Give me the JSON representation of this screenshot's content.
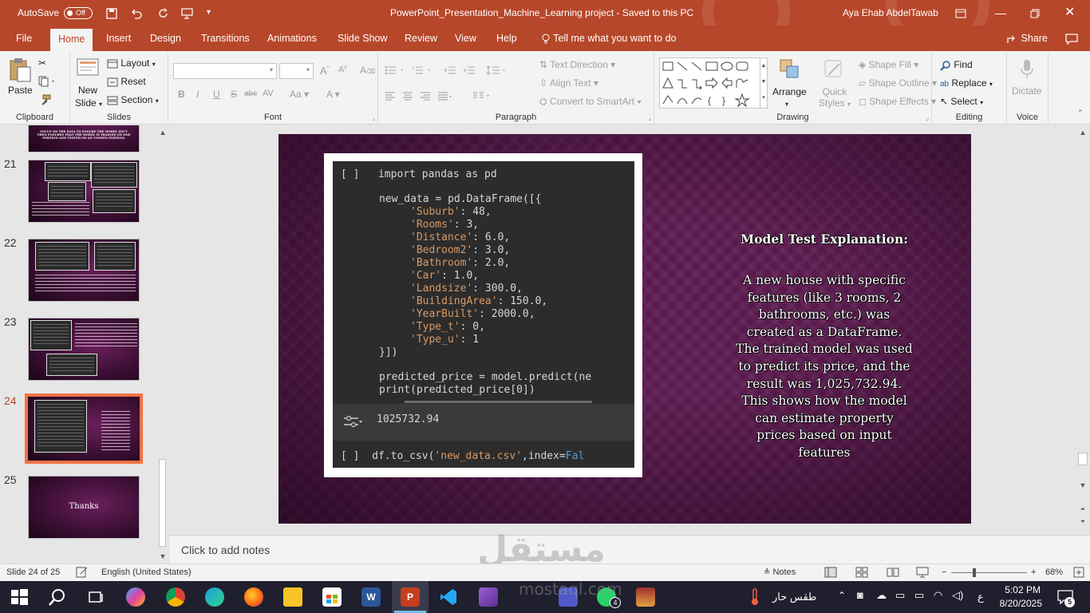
{
  "titlebar": {
    "autosave_label": "AutoSave",
    "autosave_state": "Off",
    "doc_title": "PowerPoint_Presentation_Machine_Learning project  -  Saved to this PC",
    "user_name": "Aya Ehab AbdelTawab"
  },
  "tabs": [
    "File",
    "Home",
    "Insert",
    "Design",
    "Transitions",
    "Animations",
    "Slide Show",
    "Review",
    "View",
    "Help"
  ],
  "active_tab": "Home",
  "tell_me": "Tell me what you want to do",
  "share": "Share",
  "ribbon": {
    "clipboard": {
      "label": "Clipboard",
      "paste": "Paste"
    },
    "slides": {
      "label": "Slides",
      "new_slide_1": "New",
      "new_slide_2": "Slide",
      "layout": "Layout",
      "reset": "Reset",
      "section": "Section"
    },
    "font": {
      "label": "Font"
    },
    "paragraph": {
      "label": "Paragraph",
      "text_direction": "Text Direction",
      "align_text": "Align Text",
      "convert": "Convert to SmartArt"
    },
    "drawing": {
      "label": "Drawing",
      "arrange": "Arrange",
      "quick_1": "Quick",
      "quick_2": "Styles",
      "shape_fill": "Shape Fill",
      "shape_outline": "Shape Outline",
      "shape_effects": "Shape Effects"
    },
    "editing": {
      "label": "Editing",
      "find": "Find",
      "replace": "Replace",
      "select": "Select"
    },
    "voice": {
      "label": "Voice",
      "dictate": "Dictate"
    }
  },
  "thumbnails": {
    "top_text_1": "FOCUS ON THE DATA TO ENSURE THE MODEL ISN'T",
    "top_text_2": "THEN ENSURES THAT THE MODEL IS TRAINED ON ONE",
    "top_text_3": "PORTION AND TESTED ON AN UNSEEN PORTION.",
    "numbers": [
      "21",
      "22",
      "23",
      "24",
      "25"
    ],
    "thanks": "Thanks",
    "selected": "24"
  },
  "slide": {
    "code_lines": [
      {
        "prefix": "[ ]  ",
        "text": "import pandas as pd"
      },
      {
        "prefix": "",
        "text": "new_data = pd.DataFrame([{"
      },
      {
        "key": "'Suburb'",
        "val": ": 48,"
      },
      {
        "key": "'Rooms'",
        "val": ": 3,"
      },
      {
        "key": "'Distance'",
        "val": ": 6.0,"
      },
      {
        "key": "'Bedroom2'",
        "val": ": 3.0,"
      },
      {
        "key": "'Bathroom'",
        "val": ": 2.0,"
      },
      {
        "key": "'Car'",
        "val": ": 1.0,"
      },
      {
        "key": "'Landsize'",
        "val": ": 300.0,"
      },
      {
        "key": "'BuildingArea'",
        "val": ": 150.0,"
      },
      {
        "key": "'YearBuilt'",
        "val": ": 2000.0,"
      },
      {
        "key": "'Type_t'",
        "val": ": 0,"
      },
      {
        "key": "'Type_u'",
        "val": ": 1"
      }
    ],
    "close_line": "}])",
    "predict_line": "predicted_price = model.predict(ne",
    "print_line": "print(predicted_price[0])",
    "output_value": "1025732.94",
    "cell_marker": "[ ]",
    "csv_line_a": "df.to_csv(",
    "csv_line_str": "'new_data.csv'",
    "csv_line_b": ",index=",
    "csv_line_kw": "Fal",
    "explain_title": "Model Test Explanation:",
    "explain_body": "A new house with specific features (like 3 rooms, 2 bathrooms, etc.) was created as a DataFrame. The trained model was used to predict its price, and the result was 1,025,732.94. This shows how the model can estimate property prices based on input features"
  },
  "notes_placeholder": "Click to add notes",
  "status": {
    "slide_info": "Slide 24 of 25",
    "language": "English (United States)",
    "notes": "Notes",
    "zoom": "68%"
  },
  "taskbar": {
    "weather": "طقس حار",
    "lang": "ع",
    "time": "5:02 PM",
    "date": "8/20/2025",
    "whatsapp_badge": "4",
    "notif_badge": "5"
  },
  "watermark": {
    "arabic": "مستقل",
    "latin": "mostaql.com"
  },
  "colors": {
    "accent": "#b7472a",
    "slide_bg": "#5a1a4e",
    "selected_thumb": "#f27243"
  }
}
